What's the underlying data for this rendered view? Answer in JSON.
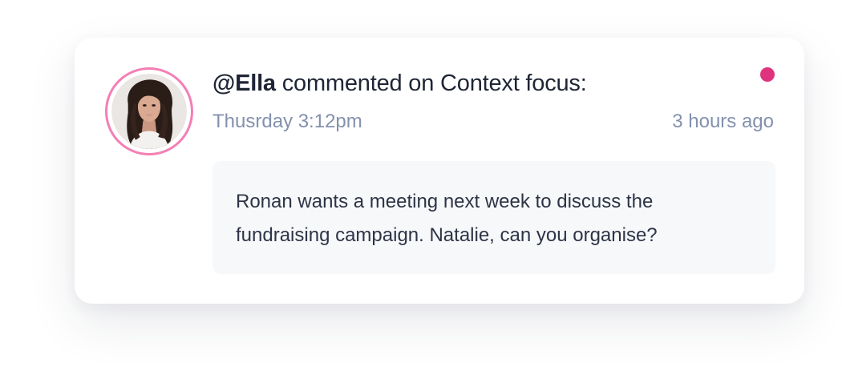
{
  "notification": {
    "author": "@Ella",
    "action": " commented on Context focus:",
    "date": "Thusrday 3:12pm",
    "relative_time": "3 hours ago",
    "comment": "Ronan wants a meeting next week to discuss the fundraising campaign. Natalie, can you organise?",
    "unread": true
  },
  "colors": {
    "avatar_ring": "#f47fb4",
    "unread_dot": "#e0337e",
    "headline_text": "#1f2535",
    "meta_text": "#8391ae",
    "comment_bg": "#f7f8fa"
  }
}
